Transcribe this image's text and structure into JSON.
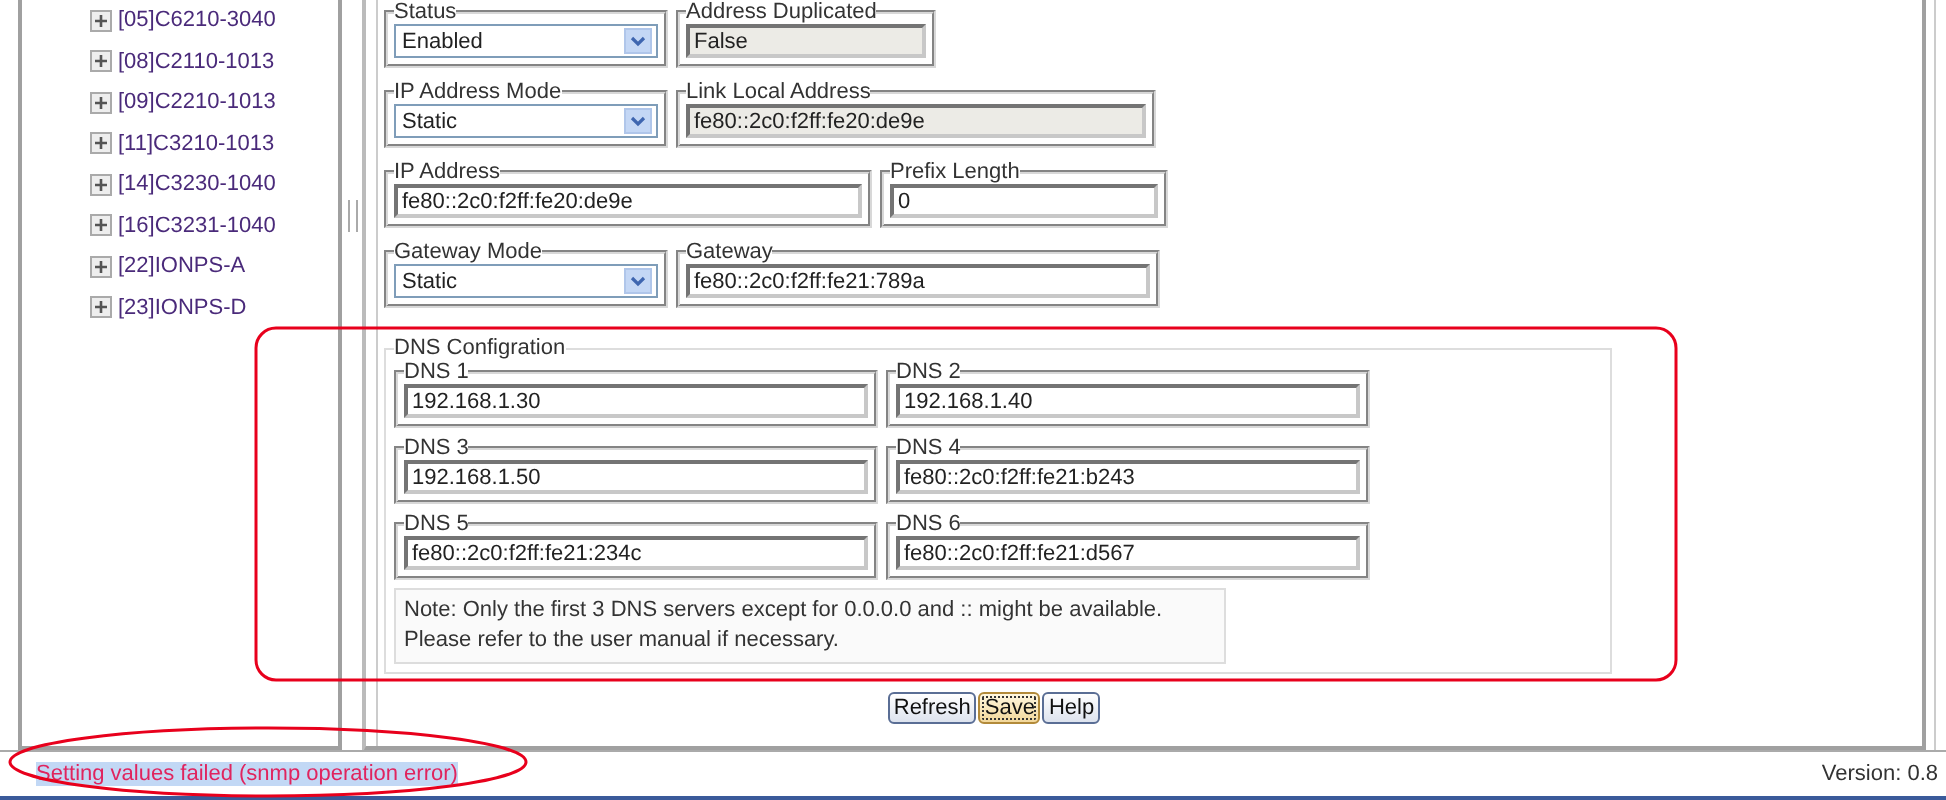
{
  "tree": {
    "items": [
      {
        "label": "[05]C6210-3040",
        "expanded": false
      },
      {
        "label": "[08]C2110-1013",
        "expanded": false
      },
      {
        "label": "[09]C2210-1013",
        "expanded": false
      },
      {
        "label": "[11]C3210-1013",
        "expanded": false
      },
      {
        "label": "[14]C3230-1040",
        "expanded": false
      },
      {
        "label": "[16]C3231-1040",
        "expanded": false
      },
      {
        "label": "[22]IONPS-A",
        "expanded": false
      },
      {
        "label": "[23]IONPS-D",
        "expanded": false
      }
    ]
  },
  "form": {
    "rows": [
      [
        {
          "kind": "select",
          "label": "Status",
          "value": "Enabled"
        },
        {
          "kind": "readonly",
          "label": "Address Duplicated",
          "value": "False"
        }
      ],
      [
        {
          "kind": "select",
          "label": "IP Address Mode",
          "value": "Static"
        },
        {
          "kind": "readonly",
          "label": "Link Local Address",
          "value": "fe80::2c0:f2ff:fe20:de9e"
        }
      ],
      [
        {
          "kind": "text",
          "label": "IP Address",
          "value": "fe80::2c0:f2ff:fe20:de9e"
        },
        {
          "kind": "text",
          "label": "Prefix Length",
          "value": "0"
        }
      ],
      [
        {
          "kind": "select",
          "label": "Gateway Mode",
          "value": "Static"
        },
        {
          "kind": "text",
          "label": "Gateway",
          "value": "fe80::2c0:f2ff:fe21:789a"
        }
      ]
    ]
  },
  "dns": {
    "title": "DNS Configration",
    "fields": [
      {
        "label": "DNS 1",
        "value": "192.168.1.30"
      },
      {
        "label": "DNS 2",
        "value": "192.168.1.40"
      },
      {
        "label": "DNS 3",
        "value": "192.168.1.50"
      },
      {
        "label": "DNS 4",
        "value": "fe80::2c0:f2ff:fe21:b243"
      },
      {
        "label": "DNS 5",
        "value": "fe80::2c0:f2ff:fe21:234c"
      },
      {
        "label": "DNS 6",
        "value": "fe80::2c0:f2ff:fe21:d567"
      }
    ],
    "note": "Note: Only the first 3 DNS servers except for 0.0.0.0 and :: might be available.\nPlease refer to the user manual if necessary."
  },
  "buttons": [
    {
      "label": "Refresh",
      "focused": false
    },
    {
      "label": "Save",
      "focused": true
    },
    {
      "label": "Help",
      "focused": false
    }
  ],
  "status_bar": {
    "message": "Setting values failed (snmp operation error)",
    "highlighted": true,
    "version": "Version: 0.8"
  }
}
